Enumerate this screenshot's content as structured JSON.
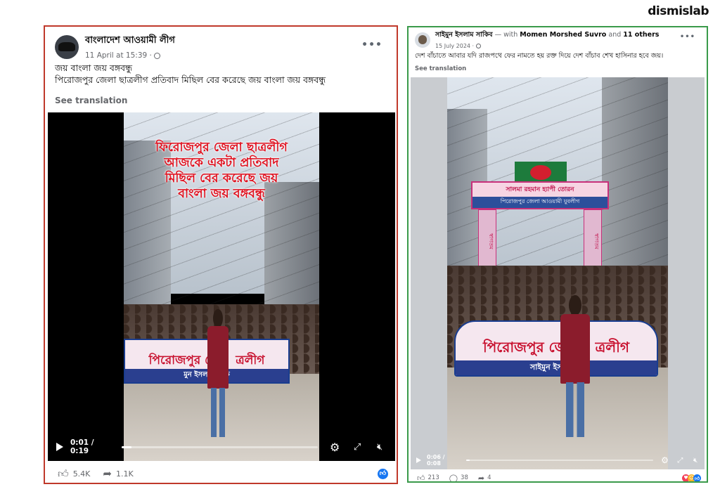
{
  "brand": "dismislab",
  "left_post": {
    "author": "বাংলাদেশ আওয়ামী লীগ",
    "timestamp": "11 April at 15:39 ·",
    "text_line1": "জয় বাংলা জয় বঙ্গবন্ধু",
    "text_line2": "পিরোজপুর জেলা ছাত্রলীগ প্রতিবাদ মিছিল বের করেছে জয় বাংলা জয় বঙ্গবন্ধু",
    "see_translation": "See translation",
    "video": {
      "overlay_lines": [
        "ফিরোজপুর জেলা ছাত্রলীগ",
        "আজকে একটা প্রতিবাদ",
        "মিছিল বের করেছে জয়",
        "বাংলা জয় বঙ্গবন্ধু"
      ],
      "banner_text": "পিরোজপুর জে",
      "banner_suffix": "ত্রলীগ",
      "banner_sub": "মুন ইসলাম সাকি",
      "time": "0:01 / 0:19",
      "progress": 0.05
    },
    "likes": "5.4K",
    "shares": "1.1K",
    "icons": {
      "like": "like-icon",
      "share": "share-icon",
      "reaction": "like-reaction-icon"
    },
    "accent": "#1877f2"
  },
  "right_post": {
    "author": "সাইমুন ইসলাম সাকিব",
    "with_text": "— with",
    "tagged": "Momen Morshed Suvro",
    "and_text": "and",
    "others": "11 others",
    "timestamp": "15 July 2024 ·",
    "text": "দেশ বাঁচাতে আবার যদি রাজপথে ফের নামতে হয় রক্ত দিয়ে দেশ বাঁচাব শেখ হাসিনার হবে জয়।",
    "see_translation": "See translation",
    "video": {
      "arch_title": "সালমা রহমান হ্যাপী তোরন",
      "arch_sub": "পিরোজপুর জেলা আওয়ামী যুবলীগ",
      "arch_side": "স্বাগতম",
      "banner_text": "পিরোজপুর জে",
      "banner_suffix": "ত্রলীগ",
      "banner_sub": "সাইমুন ইসলাম স",
      "time": "0:06 / 0:08",
      "progress": 0.02
    },
    "likes": "213",
    "comments": "38",
    "shares": "4"
  },
  "colors": {
    "left_border": "#c0392b",
    "right_border": "#3a9a4a"
  }
}
